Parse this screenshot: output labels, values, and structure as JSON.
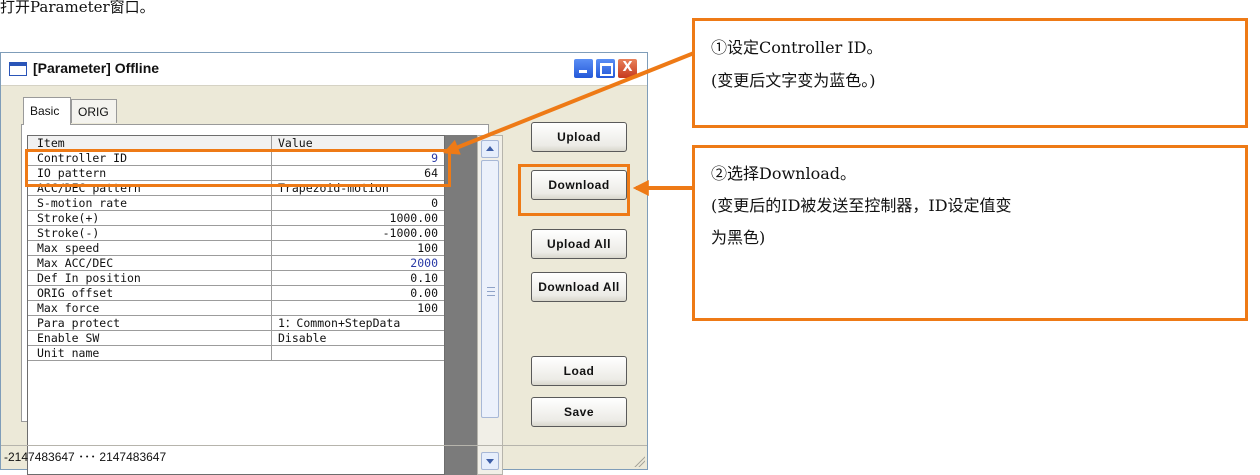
{
  "heading": "打开Parameter窗口。",
  "window": {
    "title": "[Parameter] Offline",
    "controls": {
      "minimize": "",
      "maximize": "",
      "close": "X"
    }
  },
  "tabs": [
    {
      "label": "Basic",
      "active": true
    },
    {
      "label": "ORIG",
      "active": false
    }
  ],
  "grid": {
    "columns": [
      "Item",
      "Value"
    ],
    "rows": [
      {
        "item": "Controller ID",
        "value": "9",
        "align": "right",
        "color": "#2a3aa6"
      },
      {
        "item": "IO pattern",
        "value": "64",
        "align": "right"
      },
      {
        "item": "ACC/DEC pattern",
        "value": "Trapezoid-motion",
        "align": "left"
      },
      {
        "item": "S-motion rate",
        "value": "0",
        "align": "right"
      },
      {
        "item": "Stroke(+)",
        "value": "1000.00",
        "align": "right"
      },
      {
        "item": "Stroke(-)",
        "value": "-1000.00",
        "align": "right"
      },
      {
        "item": "Max speed",
        "value": "100",
        "align": "right"
      },
      {
        "item": "Max ACC/DEC",
        "value": "2000",
        "align": "right",
        "color": "#2a3aa6"
      },
      {
        "item": "Def In position",
        "value": "0.10",
        "align": "right"
      },
      {
        "item": "ORIG offset",
        "value": "0.00",
        "align": "right"
      },
      {
        "item": "Max force",
        "value": "100",
        "align": "right"
      },
      {
        "item": "Para protect",
        "value": "1：Common+StepData",
        "align": "left"
      },
      {
        "item": "Enable SW",
        "value": "Disable",
        "align": "left"
      },
      {
        "item": "Unit name",
        "value": "",
        "align": "left"
      }
    ]
  },
  "buttons": {
    "upload": "Upload",
    "download": "Download",
    "upload_all": "Upload All",
    "download_all": "Download All",
    "load": "Load",
    "save": "Save"
  },
  "status_bar": "-2147483647 ･･･ 2147483647",
  "callouts": {
    "step1": {
      "line1": "①设定Controller ID。",
      "line2": "(变更后文字变为蓝色。)"
    },
    "step2": {
      "line1": "②选择Download。",
      "line2": "(变更后的ID被发送至控制器，ID设定值变",
      "line3": "为黑色)"
    }
  },
  "colors": {
    "highlight": "#ee7a16",
    "changed_text": "#2a3aa6"
  }
}
